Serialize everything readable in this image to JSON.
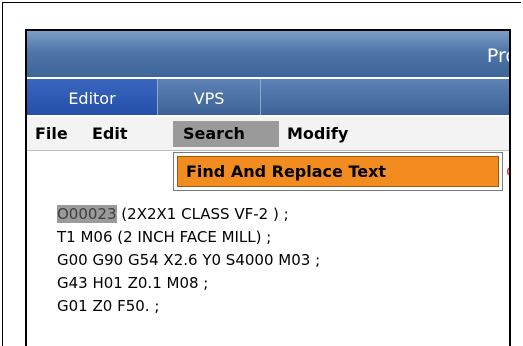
{
  "window": {
    "title": "Pro"
  },
  "tabs": [
    {
      "label": "Editor"
    },
    {
      "label": "VPS"
    }
  ],
  "menubar": {
    "file": "File",
    "edit": "Edit",
    "search": "Search",
    "modify": "Modify"
  },
  "dropdown": {
    "find_replace": "Find And Replace Text"
  },
  "program": {
    "number": "O00023",
    "first_line_rest": " (2X2X1 CLASS VF-2 ) ;",
    "lines": [
      "T1 M06 (2 INCH FACE MILL) ;",
      "G00 G90 G54 X2.6 Y0 S4000 M03 ;",
      "G43 H01 Z0.1 M08 ;",
      "G01 Z0 F50. ;"
    ]
  },
  "colors": {
    "title_blue": "#4f76aa",
    "active_tab": "#2550a8",
    "menu_highlight": "#9a9a9a",
    "dropdown_highlight": "#f28c1e"
  }
}
